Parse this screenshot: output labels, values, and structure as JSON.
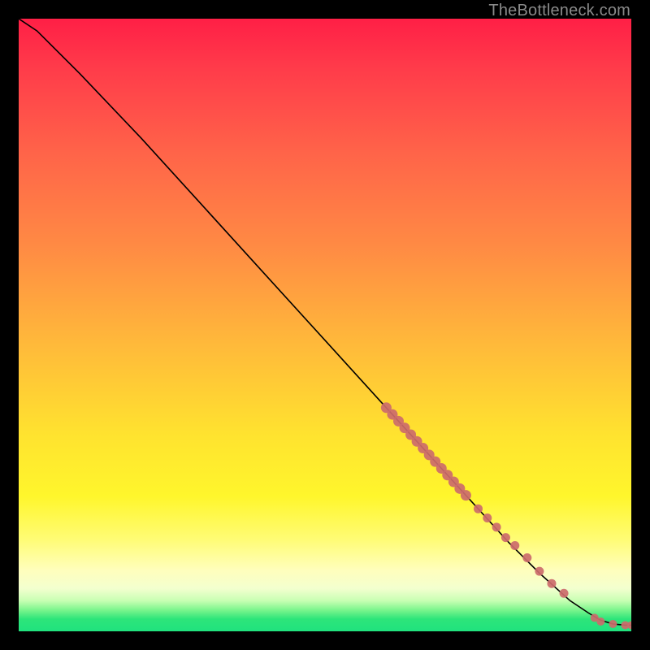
{
  "watermark": "TheBottleneck.com",
  "colors": {
    "background": "#000000",
    "curve": "#000000",
    "points": "#cc6b6b",
    "watermark": "#8a8a8a"
  },
  "chart_data": {
    "type": "line",
    "title": "",
    "xlabel": "",
    "ylabel": "",
    "xlim": [
      0,
      100
    ],
    "ylim": [
      0,
      100
    ],
    "grid": false,
    "legend": false,
    "series": [
      {
        "name": "curve",
        "style": "line",
        "x": [
          0,
          3,
          6,
          10,
          20,
          30,
          40,
          50,
          60,
          70,
          80,
          85,
          90,
          93,
          95,
          97,
          99,
          100
        ],
        "y": [
          100,
          98,
          95,
          91,
          80.5,
          69.5,
          58.5,
          47.5,
          36.5,
          25.5,
          14.5,
          9.5,
          5,
          3,
          1.8,
          1.2,
          1,
          1
        ]
      },
      {
        "name": "upper-point-cluster",
        "style": "points",
        "x": [
          60,
          61,
          62,
          63,
          64,
          65,
          66,
          67,
          68,
          69,
          70,
          71,
          72,
          73
        ],
        "y": [
          36.5,
          35.4,
          34.3,
          33.2,
          32.1,
          31.0,
          29.9,
          28.8,
          27.7,
          26.6,
          25.5,
          24.4,
          23.3,
          22.2
        ]
      },
      {
        "name": "mid-points",
        "style": "points",
        "x": [
          75,
          76.5,
          78,
          79.5,
          81,
          83,
          85,
          87,
          89
        ],
        "y": [
          20.0,
          18.5,
          17.0,
          15.3,
          14.0,
          12.0,
          9.8,
          7.8,
          6.2
        ]
      },
      {
        "name": "bottom-right-points",
        "style": "points",
        "x": [
          94,
          95,
          97,
          99,
          100
        ],
        "y": [
          2.2,
          1.6,
          1.2,
          1.0,
          1.0
        ]
      }
    ]
  }
}
